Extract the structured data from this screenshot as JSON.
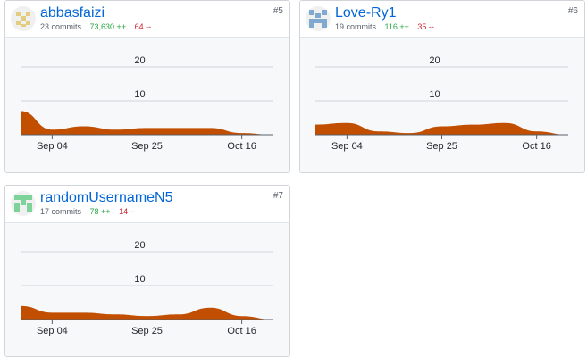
{
  "contributors": [
    {
      "username": "abbasfaizi",
      "commits": "23 commits",
      "additions": "73,630 ++",
      "deletions": "64 --",
      "rank": "#5",
      "avatar_icon": "identicon-yellow",
      "avatar_color": "#e2cc7e",
      "chart_data": {
        "type": "area",
        "x": [
          "Aug 28",
          "Sep 04",
          "Sep 11",
          "Sep 18",
          "Sep 25",
          "Oct 02",
          "Oct 09",
          "Oct 16",
          "Oct 23"
        ],
        "values": [
          7,
          1.5,
          2.5,
          1.5,
          2,
          2,
          2,
          0.5,
          0
        ],
        "ylim": [
          0,
          20
        ],
        "y_ticks": [
          "20",
          "10"
        ],
        "x_ticks": [
          "Sep 04",
          "Sep 25",
          "Oct 16"
        ],
        "color": "#c24e00"
      }
    },
    {
      "username": "Love-Ry1",
      "commits": "19 commits",
      "additions": "116 ++",
      "deletions": "35 --",
      "rank": "#6",
      "avatar_icon": "identicon-blue",
      "avatar_color": "#7fa9cf",
      "chart_data": {
        "type": "area",
        "x": [
          "Aug 28",
          "Sep 04",
          "Sep 11",
          "Sep 18",
          "Sep 25",
          "Oct 02",
          "Oct 09",
          "Oct 16",
          "Oct 23"
        ],
        "values": [
          3,
          3.5,
          1,
          0.5,
          2.5,
          3,
          3.5,
          1,
          0
        ],
        "ylim": [
          0,
          20
        ],
        "y_ticks": [
          "20",
          "10"
        ],
        "x_ticks": [
          "Sep 04",
          "Sep 25",
          "Oct 16"
        ],
        "color": "#c24e00"
      }
    },
    {
      "username": "randomUsernameN5",
      "commits": "17 commits",
      "additions": "78 ++",
      "deletions": "14 --",
      "rank": "#7",
      "avatar_icon": "identicon-green",
      "avatar_color": "#7ed39a",
      "chart_data": {
        "type": "area",
        "x": [
          "Aug 28",
          "Sep 04",
          "Sep 11",
          "Sep 18",
          "Sep 25",
          "Oct 02",
          "Oct 09",
          "Oct 16",
          "Oct 23"
        ],
        "values": [
          4,
          2,
          2,
          1.5,
          1,
          1.5,
          3.5,
          1,
          0
        ],
        "ylim": [
          0,
          20
        ],
        "y_ticks": [
          "20",
          "10"
        ],
        "x_ticks": [
          "Sep 04",
          "Sep 25",
          "Oct 16"
        ],
        "color": "#c24e00"
      }
    }
  ]
}
